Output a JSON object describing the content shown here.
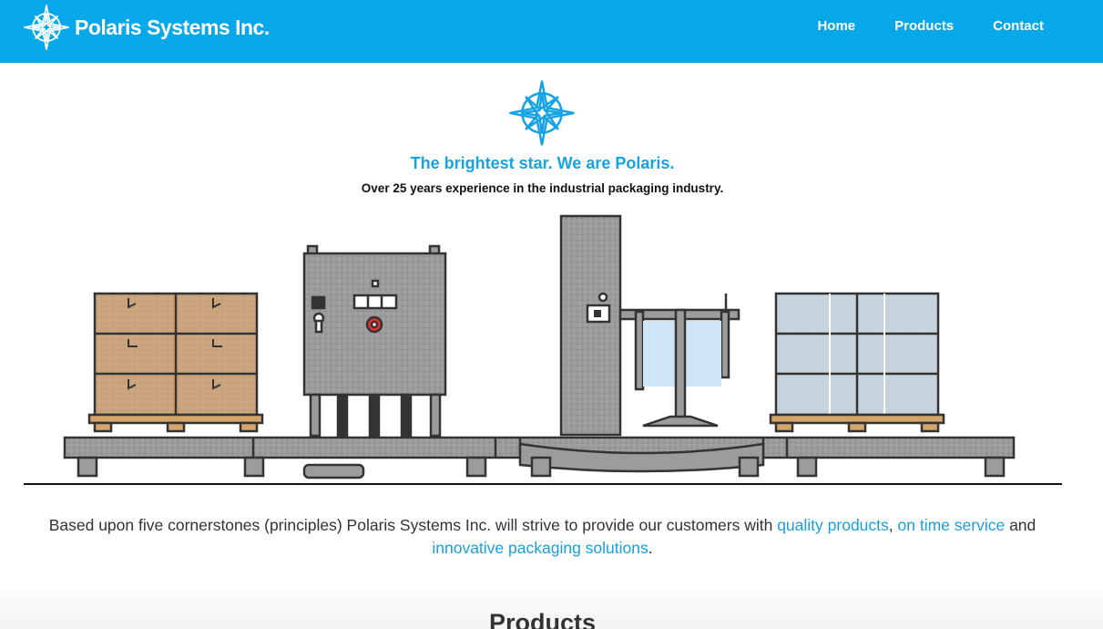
{
  "header": {
    "brand_name": "Polaris Systems Inc.",
    "nav": [
      {
        "label": "Home"
      },
      {
        "label": "Products"
      },
      {
        "label": "Contact"
      }
    ],
    "bg_color": "#07a8e9"
  },
  "hero": {
    "logo_icon": "compass-star-icon",
    "tagline": "The brightest star. We are Polaris.",
    "subtagline": "Over 25 years experience in the industrial packaging industry.",
    "illustration": "packaging-line-illustration"
  },
  "intro": {
    "text_before": "Based upon five cornerstones (principles) Polaris Systems Inc. will strive to provide our customers with ",
    "link1": "quality products",
    "sep1": ", ",
    "link2": "on time service",
    "sep2": " and ",
    "link3": "innovative packaging solutions",
    "text_after": "."
  },
  "products": {
    "heading": "Products"
  },
  "colors": {
    "accent": "#16a3e3",
    "link": "#1a9fdd"
  }
}
